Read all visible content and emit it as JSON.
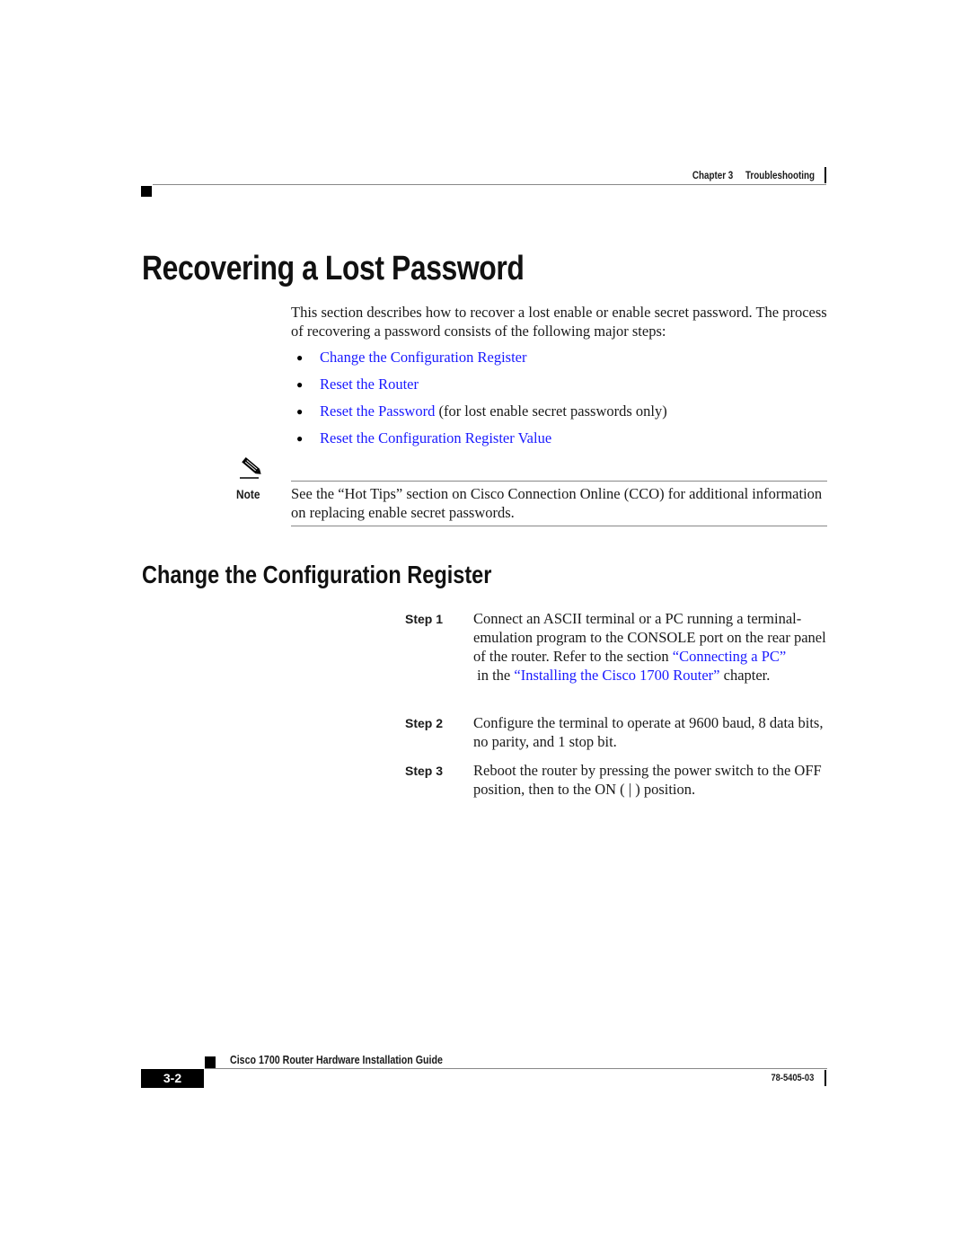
{
  "header": {
    "chapter": "Chapter 3",
    "section": "Troubleshooting"
  },
  "title": "Recovering a Lost Password",
  "intro": "This section describes how to recover a lost enable or enable secret password. The process of recovering a password consists of the following major steps:",
  "bullets": [
    {
      "link": "Change the Configuration Register",
      "suffix": ""
    },
    {
      "link": "Reset the Router",
      "suffix": ""
    },
    {
      "link": "Reset the Password",
      "suffix": " (for lost enable secret passwords only)"
    },
    {
      "link": "Reset the Configuration Register Value",
      "suffix": ""
    }
  ],
  "note": {
    "label": "Note",
    "text": "See the “Hot Tips” section on Cisco Connection Online (CCO) for additional information on replacing enable secret passwords."
  },
  "subtitle": "Change the Configuration Register",
  "steps": [
    {
      "label": "Step 1",
      "text_before": "Connect an ASCII terminal or a PC running a terminal-emulation program to the CONSOLE port on the rear panel of the router. Refer to the section ",
      "link1": "“Connecting a PC”",
      "middle": " in the ",
      "link2": "“Installing the Cisco 1700 Router”",
      "text_after": " chapter."
    },
    {
      "label": "Step 2",
      "text": "Configure the terminal to operate at 9600 baud, 8 data bits, no parity, and 1 stop bit."
    },
    {
      "label": "Step 3",
      "text": "Reboot the router by pressing the power switch to the OFF position, then to the ON ( | ) position."
    }
  ],
  "footer": {
    "guide_title": "Cisco 1700 Router Hardware Installation Guide",
    "page_number": "3-2",
    "doc_number": "78-5405-03"
  },
  "colors": {
    "link": "#1a1aff",
    "text": "#1a1a1a",
    "rule": "#888888"
  }
}
